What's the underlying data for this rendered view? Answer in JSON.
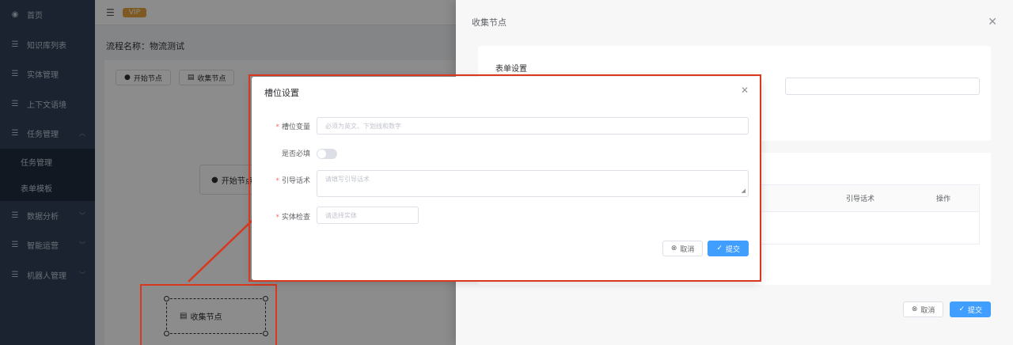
{
  "sidebar": {
    "items": [
      {
        "label": "首页",
        "icon": "dashboard-icon"
      },
      {
        "label": "知识库列表",
        "icon": "list-icon"
      },
      {
        "label": "实体管理",
        "icon": "list-icon"
      },
      {
        "label": "上下文语境",
        "icon": "list-icon"
      },
      {
        "label": "任务管理",
        "icon": "list-icon",
        "expanded": true
      }
    ],
    "sub_items": [
      {
        "label": "任务管理"
      },
      {
        "label": "表单模板"
      }
    ],
    "items_after": [
      {
        "label": "数据分析",
        "icon": "list-icon"
      },
      {
        "label": "智能运营",
        "icon": "list-icon"
      },
      {
        "label": "机器人管理",
        "icon": "list-icon"
      }
    ]
  },
  "topbar": {
    "vip": "VIP"
  },
  "flow": {
    "title": "流程名称：物流测试",
    "node_buttons": [
      {
        "label": "开始节点"
      },
      {
        "label": "收集节点"
      }
    ],
    "start_node": "开始节点",
    "collect_node": "收集节点"
  },
  "drawer": {
    "title": "收集节点",
    "card1_title": "表单设置",
    "table_headers": [
      "引导话术",
      "操作"
    ],
    "cancel": "取消",
    "submit": "提交"
  },
  "dialog": {
    "title": "槽位设置",
    "fields": {
      "slot_var": {
        "label": "槽位变量",
        "placeholder": "必须为英文、下划线和数字"
      },
      "required": {
        "label": "是否必填"
      },
      "guide": {
        "label": "引导话术",
        "placeholder": "请填写引导话术"
      },
      "entity": {
        "label": "实体检查",
        "placeholder": "请选择实体"
      }
    },
    "cancel": "取消",
    "submit": "提交"
  },
  "colors": {
    "sidebar": "#304156",
    "primary": "#409eff",
    "annotation": "#d9371f",
    "vip": "#e6a23c"
  }
}
